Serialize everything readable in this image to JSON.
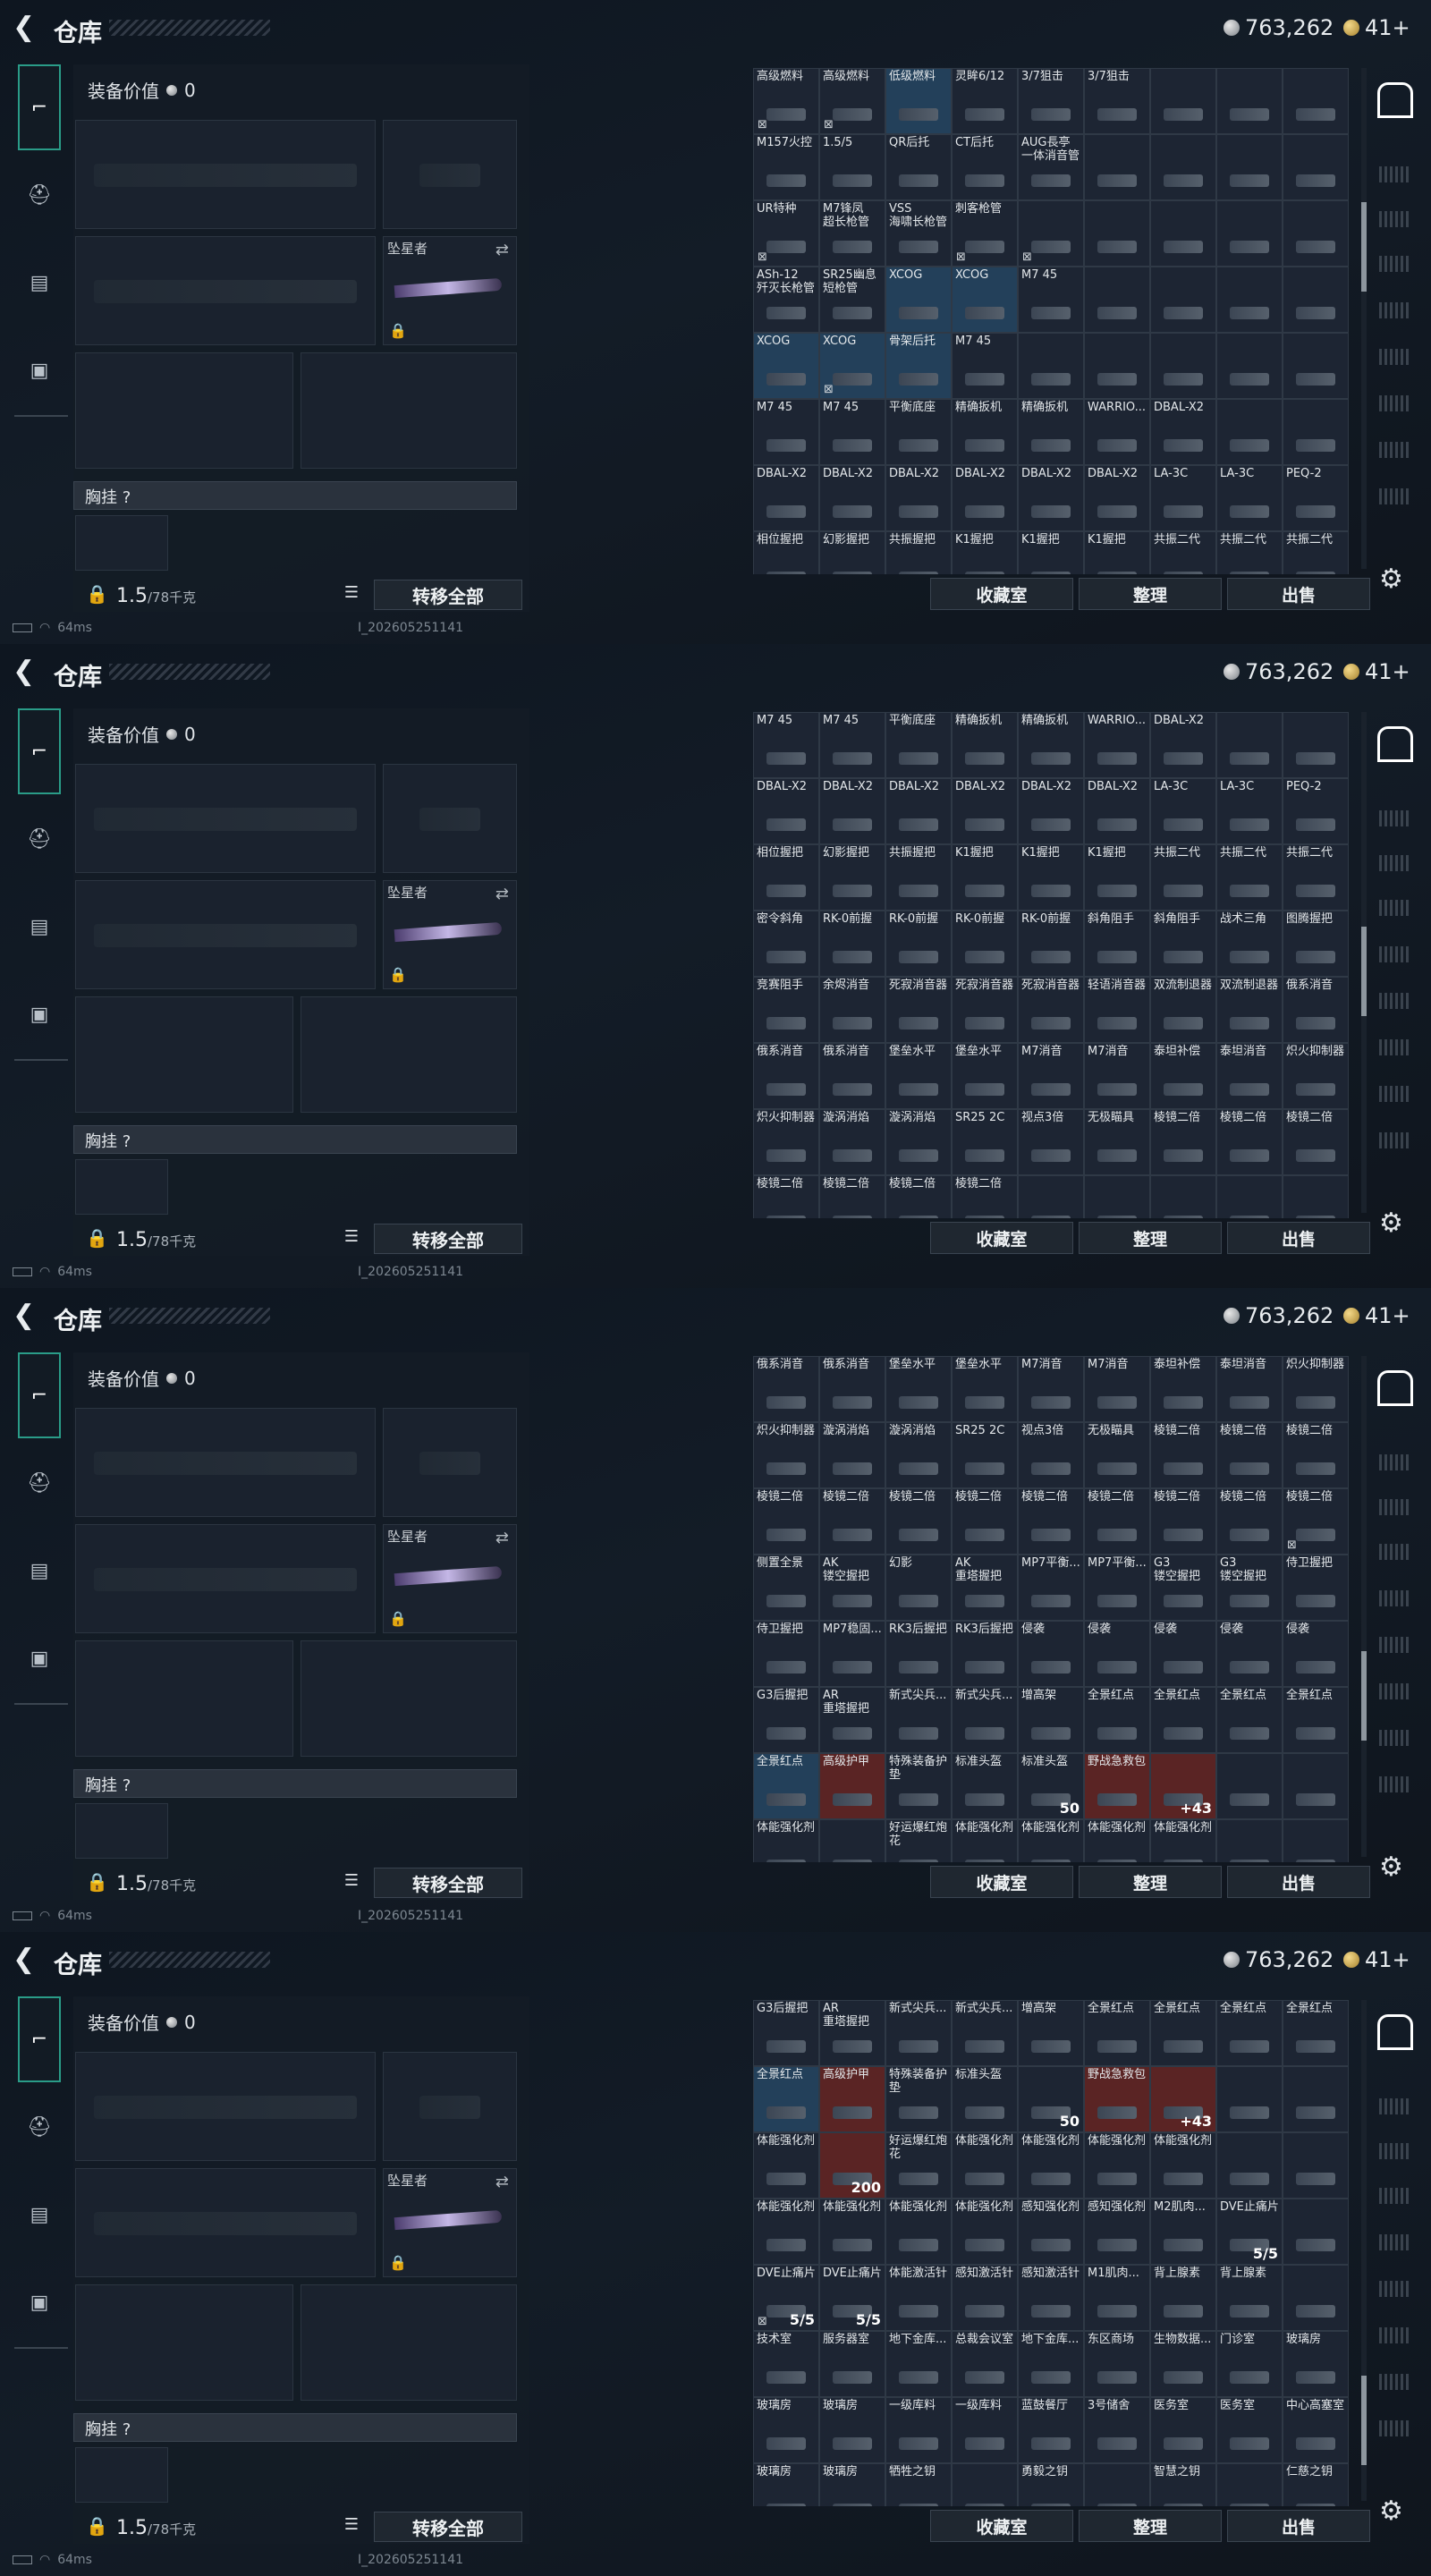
{
  "header": {
    "title": "仓库",
    "silver": "763,262",
    "gold": "41+"
  },
  "left": {
    "equip_value_label": "装备价值",
    "equip_value": "0",
    "melee_label": "坠星者",
    "chest_label": "胸挂",
    "chest_help": "?",
    "weight_value": "1.5",
    "weight_cap": "/78千克",
    "move_all": "转移全部"
  },
  "status": {
    "ping": "64ms",
    "uid": "I_202605251141"
  },
  "buttons": {
    "collection": "收藏室",
    "sort": "整理",
    "sell": "出售"
  },
  "screens": [
    {
      "cells": [
        {
          "n": "高级燃料",
          "m": "⊠"
        },
        {
          "n": "高级燃料",
          "m": "⊠"
        },
        {
          "n": "低级燃料",
          "h": 1
        },
        {
          "n": "灵眸6/12"
        },
        {
          "n": "3/7狙击"
        },
        {
          "n": "3/7狙击"
        },
        {
          "n": ""
        },
        {
          "n": ""
        },
        {
          "n": ""
        },
        {
          "n": "M157火控"
        },
        {
          "n": "1.5/5"
        },
        {
          "n": "QR后托"
        },
        {
          "n": "CT后托"
        },
        {
          "n": "AUG長亭\n一体消音管"
        },
        {
          "n": ""
        },
        {
          "n": ""
        },
        {
          "n": ""
        },
        {
          "n": ""
        },
        {
          "n": "UR特种",
          "m": "⊠"
        },
        {
          "n": "M7锋凤\n超长枪管"
        },
        {
          "n": "VSS\n海啸长枪管"
        },
        {
          "n": "刺客枪管",
          "m": "⊠"
        },
        {
          "n": "",
          "m": "⊠"
        },
        {
          "n": ""
        },
        {
          "n": ""
        },
        {
          "n": ""
        },
        {
          "n": ""
        },
        {
          "n": "ASh-12\n歼灭长枪管"
        },
        {
          "n": "SR25幽息\n短枪管"
        },
        {
          "n": "XCOG",
          "h": 1
        },
        {
          "n": "XCOG",
          "h": 1
        },
        {
          "n": "M7 45"
        },
        {
          "n": ""
        },
        {
          "n": ""
        },
        {
          "n": ""
        },
        {
          "n": ""
        },
        {
          "n": "XCOG",
          "h": 1
        },
        {
          "n": "XCOG",
          "h": 1,
          "m": "⊠"
        },
        {
          "n": "骨架后托",
          "h": 1
        },
        {
          "n": "M7 45"
        },
        {
          "n": ""
        },
        {
          "n": ""
        },
        {
          "n": ""
        },
        {
          "n": ""
        },
        {
          "n": ""
        },
        {
          "n": "M7 45"
        },
        {
          "n": "M7 45"
        },
        {
          "n": "平衡底座"
        },
        {
          "n": "精确扳机"
        },
        {
          "n": "精确扳机"
        },
        {
          "n": "WARRIO..."
        },
        {
          "n": "DBAL-X2"
        },
        {
          "n": ""
        },
        {
          "n": ""
        },
        {
          "n": "DBAL-X2"
        },
        {
          "n": "DBAL-X2"
        },
        {
          "n": "DBAL-X2"
        },
        {
          "n": "DBAL-X2"
        },
        {
          "n": "DBAL-X2"
        },
        {
          "n": "DBAL-X2"
        },
        {
          "n": "LA-3C"
        },
        {
          "n": "LA-3C"
        },
        {
          "n": "PEQ-2"
        },
        {
          "n": "相位握把"
        },
        {
          "n": "幻影握把"
        },
        {
          "n": "共振握把"
        },
        {
          "n": "K1握把"
        },
        {
          "n": "K1握把"
        },
        {
          "n": "K1握把"
        },
        {
          "n": "共振二代"
        },
        {
          "n": "共振二代"
        },
        {
          "n": "共振二代"
        }
      ]
    },
    {
      "cells": [
        {
          "n": "M7 45"
        },
        {
          "n": "M7 45"
        },
        {
          "n": "平衡底座"
        },
        {
          "n": "精确扳机"
        },
        {
          "n": "精确扳机"
        },
        {
          "n": "WARRIO..."
        },
        {
          "n": "DBAL-X2"
        },
        {
          "n": ""
        },
        {
          "n": ""
        },
        {
          "n": "DBAL-X2"
        },
        {
          "n": "DBAL-X2"
        },
        {
          "n": "DBAL-X2"
        },
        {
          "n": "DBAL-X2"
        },
        {
          "n": "DBAL-X2"
        },
        {
          "n": "DBAL-X2"
        },
        {
          "n": "LA-3C"
        },
        {
          "n": "LA-3C"
        },
        {
          "n": "PEQ-2"
        },
        {
          "n": "相位握把"
        },
        {
          "n": "幻影握把"
        },
        {
          "n": "共振握把"
        },
        {
          "n": "K1握把"
        },
        {
          "n": "K1握把"
        },
        {
          "n": "K1握把"
        },
        {
          "n": "共振二代"
        },
        {
          "n": "共振二代"
        },
        {
          "n": "共振二代"
        },
        {
          "n": "密令斜角"
        },
        {
          "n": "RK-0前握"
        },
        {
          "n": "RK-0前握"
        },
        {
          "n": "RK-0前握"
        },
        {
          "n": "RK-0前握"
        },
        {
          "n": "斜角阻手"
        },
        {
          "n": "斜角阻手"
        },
        {
          "n": "战术三角"
        },
        {
          "n": "图腾握把"
        },
        {
          "n": "竞赛阻手"
        },
        {
          "n": "余烬消音"
        },
        {
          "n": "死寂消音器"
        },
        {
          "n": "死寂消音器"
        },
        {
          "n": "死寂消音器"
        },
        {
          "n": "轻语消音器"
        },
        {
          "n": "双流制退器"
        },
        {
          "n": "双流制退器"
        },
        {
          "n": "俄系消音"
        },
        {
          "n": "俄系消音"
        },
        {
          "n": "俄系消音"
        },
        {
          "n": "堡垒水平"
        },
        {
          "n": "堡垒水平"
        },
        {
          "n": "M7消音"
        },
        {
          "n": "M7消音"
        },
        {
          "n": "泰坦补偿"
        },
        {
          "n": "泰坦消音"
        },
        {
          "n": "炽火抑制器"
        },
        {
          "n": "炽火抑制器"
        },
        {
          "n": "漩涡消焰"
        },
        {
          "n": "漩涡消焰"
        },
        {
          "n": "SR25 2C"
        },
        {
          "n": "视点3倍"
        },
        {
          "n": "无极瞄具"
        },
        {
          "n": "棱镜二倍"
        },
        {
          "n": "棱镜二倍"
        },
        {
          "n": "棱镜二倍"
        },
        {
          "n": "棱镜二倍"
        },
        {
          "n": "棱镜二倍"
        },
        {
          "n": "棱镜二倍"
        },
        {
          "n": "棱镜二倍"
        },
        {
          "n": ""
        },
        {
          "n": ""
        },
        {
          "n": ""
        },
        {
          "n": ""
        },
        {
          "n": ""
        }
      ]
    },
    {
      "cells": [
        {
          "n": "俄系消音"
        },
        {
          "n": "俄系消音"
        },
        {
          "n": "堡垒水平"
        },
        {
          "n": "堡垒水平"
        },
        {
          "n": "M7消音"
        },
        {
          "n": "M7消音"
        },
        {
          "n": "泰坦补偿"
        },
        {
          "n": "泰坦消音"
        },
        {
          "n": "炽火抑制器"
        },
        {
          "n": "炽火抑制器"
        },
        {
          "n": "漩涡消焰"
        },
        {
          "n": "漩涡消焰"
        },
        {
          "n": "SR25 2C"
        },
        {
          "n": "视点3倍"
        },
        {
          "n": "无极瞄具"
        },
        {
          "n": "棱镜二倍"
        },
        {
          "n": "棱镜二倍"
        },
        {
          "n": "棱镜二倍"
        },
        {
          "n": "棱镜二倍"
        },
        {
          "n": "棱镜二倍"
        },
        {
          "n": "棱镜二倍"
        },
        {
          "n": "棱镜二倍"
        },
        {
          "n": "棱镜二倍"
        },
        {
          "n": "棱镜二倍"
        },
        {
          "n": "棱镜二倍"
        },
        {
          "n": "棱镜二倍"
        },
        {
          "n": "棱镜二倍",
          "m": "⊠"
        },
        {
          "n": "侧置全景"
        },
        {
          "n": "AK\n镂空握把"
        },
        {
          "n": "幻影"
        },
        {
          "n": "AK\n重塔握把"
        },
        {
          "n": "MP7平衡..."
        },
        {
          "n": "MP7平衡..."
        },
        {
          "n": "G3\n镂空握把"
        },
        {
          "n": "G3\n镂空握把"
        },
        {
          "n": "侍卫握把"
        },
        {
          "n": "侍卫握把"
        },
        {
          "n": "MP7稳固..."
        },
        {
          "n": "RK3后握把"
        },
        {
          "n": "RK3后握把"
        },
        {
          "n": "侵袭"
        },
        {
          "n": "侵袭"
        },
        {
          "n": "侵袭"
        },
        {
          "n": "侵袭"
        },
        {
          "n": "侵袭"
        },
        {
          "n": "G3后握把"
        },
        {
          "n": "AR\n重塔握把"
        },
        {
          "n": "新式尖兵..."
        },
        {
          "n": "新式尖兵..."
        },
        {
          "n": "增高架"
        },
        {
          "n": "全景红点"
        },
        {
          "n": "全景红点"
        },
        {
          "n": "全景红点"
        },
        {
          "n": "全景红点"
        },
        {
          "n": "全景红点",
          "h": 1
        },
        {
          "n": "高级护甲",
          "r": 1
        },
        {
          "n": "特殊装备护垫"
        },
        {
          "n": "标准头盔"
        },
        {
          "n": "标准头盔",
          "c": "50"
        },
        {
          "n": "野战急救包",
          "r": 1
        },
        {
          "n": "",
          "r": 1,
          "c": "+43"
        },
        {
          "n": ""
        },
        {
          "n": ""
        },
        {
          "n": "体能强化剂"
        },
        {
          "n": ""
        },
        {
          "n": "好运爆红炮花"
        },
        {
          "n": "体能强化剂"
        },
        {
          "n": "体能强化剂"
        },
        {
          "n": "体能强化剂"
        },
        {
          "n": "体能强化剂"
        },
        {
          "n": ""
        },
        {
          "n": ""
        }
      ]
    },
    {
      "cells": [
        {
          "n": "G3后握把"
        },
        {
          "n": "AR\n重塔握把"
        },
        {
          "n": "新式尖兵..."
        },
        {
          "n": "新式尖兵..."
        },
        {
          "n": "增高架"
        },
        {
          "n": "全景红点"
        },
        {
          "n": "全景红点"
        },
        {
          "n": "全景红点"
        },
        {
          "n": "全景红点"
        },
        {
          "n": "全景红点",
          "h": 1
        },
        {
          "n": "高级护甲",
          "r": 1
        },
        {
          "n": "特殊装备护垫"
        },
        {
          "n": "标准头盔"
        },
        {
          "n": "",
          "c": "50"
        },
        {
          "n": "野战急救包",
          "r": 1
        },
        {
          "n": "",
          "r": 1,
          "c": "+43"
        },
        {
          "n": ""
        },
        {
          "n": ""
        },
        {
          "n": "体能强化剂"
        },
        {
          "n": "",
          "r": 1,
          "c": "200"
        },
        {
          "n": "好运爆红炮花"
        },
        {
          "n": "体能强化剂"
        },
        {
          "n": "体能强化剂"
        },
        {
          "n": "体能强化剂"
        },
        {
          "n": "体能强化剂"
        },
        {
          "n": ""
        },
        {
          "n": ""
        },
        {
          "n": "体能强化剂"
        },
        {
          "n": "体能强化剂"
        },
        {
          "n": "体能强化剂"
        },
        {
          "n": "体能强化剂"
        },
        {
          "n": "感知强化剂"
        },
        {
          "n": "感知强化剂"
        },
        {
          "n": "M2肌肉..."
        },
        {
          "n": "DVE止痛片",
          "c": "5/5"
        },
        {
          "n": ""
        },
        {
          "n": "DVE止痛片",
          "c": "5/5",
          "m": "⊠"
        },
        {
          "n": "DVE止痛片",
          "c": "5/5"
        },
        {
          "n": "体能激活针"
        },
        {
          "n": "感知激活针"
        },
        {
          "n": "感知激活针"
        },
        {
          "n": "M1肌肉..."
        },
        {
          "n": "背上腺素"
        },
        {
          "n": "背上腺素"
        },
        {
          "n": ""
        },
        {
          "n": "技术室"
        },
        {
          "n": "服务器室"
        },
        {
          "n": "地下金库..."
        },
        {
          "n": "总裁会议室"
        },
        {
          "n": "地下金库..."
        },
        {
          "n": "东区商场"
        },
        {
          "n": "生物数据..."
        },
        {
          "n": "门诊室"
        },
        {
          "n": "玻璃房"
        },
        {
          "n": "玻璃房"
        },
        {
          "n": "玻璃房"
        },
        {
          "n": "一级库料"
        },
        {
          "n": "一级库料"
        },
        {
          "n": "蓝鼓餐厅"
        },
        {
          "n": "3号储舍"
        },
        {
          "n": "医务室"
        },
        {
          "n": "医务室"
        },
        {
          "n": "中心高塞室"
        },
        {
          "n": "玻璃房"
        },
        {
          "n": "玻璃房"
        },
        {
          "n": "牺牲之钥"
        },
        {
          "n": ""
        },
        {
          "n": "勇毅之钥"
        },
        {
          "n": ""
        },
        {
          "n": "智慧之钥"
        },
        {
          "n": ""
        },
        {
          "n": "仁慈之钥"
        }
      ]
    }
  ]
}
